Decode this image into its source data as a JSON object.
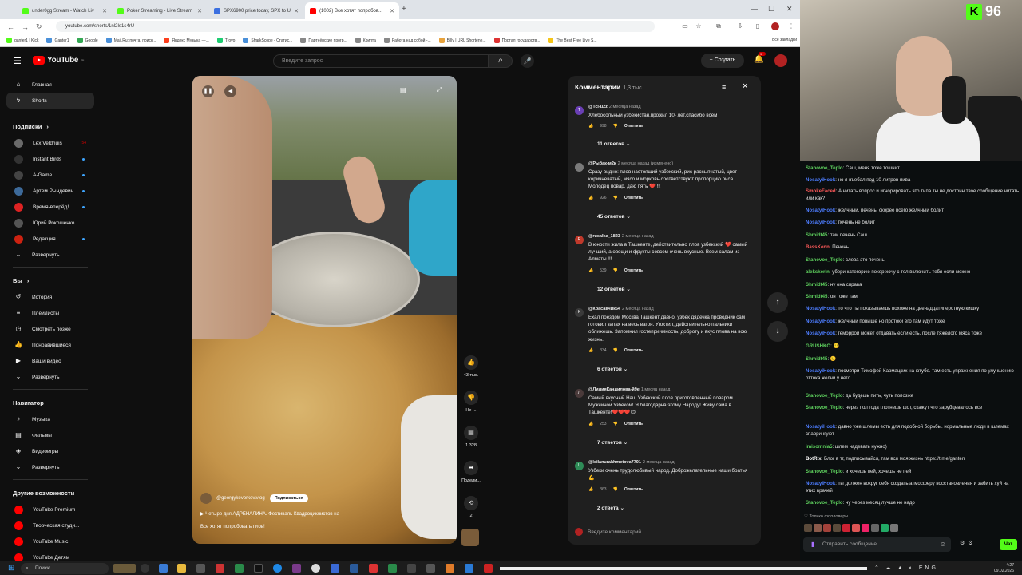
{
  "browser": {
    "tabs": [
      {
        "label": "under0gg Stream - Watch Liv",
        "color": "#53fc18"
      },
      {
        "label": "Poker Streaming - Live Stream",
        "color": "#53fc18"
      },
      {
        "label": "SPX6900 price today, SPX to U",
        "color": "#3b6fe0"
      },
      {
        "label": "(1002) Все хотят попробов...",
        "color": "#ff0000"
      }
    ],
    "url": "youtube.com/shorts/1nl2Is1s4rU",
    "bookmarks": [
      "ganter1 | Kick",
      "Ganter1",
      "Google",
      "Mail.Ru: почта, поиск...",
      "Яндекс Музыка —...",
      "Trovo",
      "SharkScope - Статис...",
      "Партнёрские прогр...",
      "Крипта",
      "Работа над собой -...",
      "Billy | URL Shortene...",
      "Портал государств...",
      "The Best Free Live S..."
    ],
    "all_bookmarks": "Все закладки"
  },
  "youtube": {
    "logo": "YouTube",
    "logo_sup": "RU",
    "search_placeholder": "Введите запрос",
    "create_label": "Создать",
    "notif_count": "9+",
    "sidebar": {
      "main": [
        {
          "label": "Главная",
          "icon": "home-icon",
          "glyph": "⌂"
        },
        {
          "label": "Shorts",
          "icon": "shorts-icon",
          "glyph": "ϟ"
        }
      ],
      "subs_header": "Подписки",
      "subs": [
        {
          "label": "Lex Veldhuis",
          "color": "#6a6a6a",
          "count": "54"
        },
        {
          "label": "Instant Birds",
          "color": "#333"
        },
        {
          "label": "A-Game",
          "color": "#444"
        },
        {
          "label": "Артем Рындевич",
          "color": "#3d6a9a"
        },
        {
          "label": "Время-вперёд!",
          "color": "#d22"
        },
        {
          "label": "Юрий Рокошенко",
          "color": "#555"
        },
        {
          "label": "Редакция",
          "color": "#c21"
        }
      ],
      "expand": "Развернуть",
      "you_header": "Вы",
      "you": [
        {
          "label": "История",
          "glyph": "↺",
          "icon": "history-icon"
        },
        {
          "label": "Плейлисты",
          "glyph": "≡",
          "icon": "playlists-icon"
        },
        {
          "label": "Смотреть позже",
          "glyph": "◷",
          "icon": "watch-later-icon"
        },
        {
          "label": "Понравившиеся",
          "glyph": "👍",
          "icon": "liked-icon"
        },
        {
          "label": "Ваши видео",
          "glyph": "▶",
          "icon": "your-videos-icon"
        },
        {
          "label": "Развернуть",
          "glyph": "⌄",
          "icon": "chevron-down-icon"
        }
      ],
      "nav_header": "Навигатор",
      "nav": [
        {
          "label": "Музыка",
          "glyph": "♪",
          "icon": "music-icon"
        },
        {
          "label": "Фильмы",
          "glyph": "🎞",
          "icon": "films-icon"
        },
        {
          "label": "Видеоигры",
          "glyph": "🎮",
          "icon": "games-icon"
        },
        {
          "label": "Развернуть",
          "glyph": "⌄",
          "icon": "chevron-down-icon"
        }
      ],
      "more_header": "Другие возможности",
      "more": [
        {
          "label": "YouTube Premium",
          "color": "#f00"
        },
        {
          "label": "Творческая студи...",
          "color": "#f00"
        },
        {
          "label": "YouTube Music",
          "color": "#f00"
        },
        {
          "label": "YouTube Детям",
          "color": "#f00"
        }
      ]
    },
    "video": {
      "channel": "@georgykevorkov.vlog",
      "subscribe": "Подписаться",
      "title_line1": "Четыре дня АДРЕНАЛИНА. Фестиваль Квадроциклистов на",
      "title_line2": "Все хотят попробовать плов!"
    },
    "actions": {
      "likes": "43 тыс.",
      "dislike": "Не ...",
      "comments": "1 328",
      "share": "Подели...",
      "remix": "2"
    },
    "comments_panel": {
      "title": "Комментарии",
      "count": "1,3 тыс.",
      "input_placeholder": "Введите комментарий",
      "reply_label": "Ответить",
      "items": [
        {
          "author": "@Tcl-u2z",
          "time": "2 месяца назад",
          "avatar_letter": "T",
          "avatar_color": "#6a3fb5",
          "text": "Хлебосольный узбекистан.прожил 10- лет.спасибо всем",
          "likes": "998",
          "replies": "11 ответов"
        },
        {
          "author": "@Рыбак-м2к",
          "time": "2 месяца назад (изменено)",
          "avatar_letter": "",
          "avatar_color": "#7a7a7a",
          "text": "Сразу видно: плов настоящий узбекский, рис рассыпчатый, цвет коричневатый, мясо и морковь соответствуют пропорцию риса. Молодец повар, даю пять ❤️ !!!",
          "likes": "926",
          "replies": "45 ответов"
        },
        {
          "author": "@rusalka_1823",
          "time": "2 месяца назад",
          "avatar_letter": "R",
          "avatar_color": "#c0392b",
          "text": "В юности жила в Ташкенте, действительно плов узбекский ❤️ самый лучший, а овощи и фрукты совсем очень вкусные. Всем салам из Алматы !!!",
          "likes": "539",
          "replies": "12 ответов"
        },
        {
          "author": "@Красавчик54",
          "time": "2 месяца назад",
          "avatar_letter": "K",
          "avatar_color": "#3a3a3a",
          "text": "Ехал поездом Москва Ташкент давно, узбек дядечка проводник сам готовил запах на весь вагон. Угостил, действительно пальчики оближешь. Запомнил гостеприимность, доброту и вкус плова на всю жизнь.",
          "likes": "334",
          "replies": "6 ответов"
        },
        {
          "author": "@ЛилияКандилова-й9е",
          "time": "1 месяц назад",
          "avatar_letter": "Л",
          "avatar_color": "#4a3a3a",
          "text": "Самый вкусный Наш Узбекский плов приготовленный поваром Мужчиной Узбеком! Я благодарна этому Народу! Живу сама в Ташкенте!❤️❤️❤️😊",
          "likes": "253",
          "replies": "7 ответов"
        },
        {
          "author": "@leilanurakhmetova7701",
          "time": "2 месяца назад",
          "avatar_letter": "L",
          "avatar_color": "#2e8b57",
          "text": "Узбеки очень трудолюбивый народ. Доброжелательные наши братья💪",
          "likes": "363",
          "replies": "2 ответа"
        }
      ]
    }
  },
  "stream": {
    "viewer_count": "96",
    "chat": [
      {
        "user": "Stanovoe_Teplo",
        "color": "#5fd35f",
        "text": "Саш, меня тоже тошнит"
      },
      {
        "user": "NosatyiHook",
        "color": "#4d7dff",
        "text": "но я въебал под 10 литров пива"
      },
      {
        "user": "SmokeFaced",
        "color": "#ff5a5a",
        "text": "А читать вопрос и игнорировать это типа ты не достоин твое сообщение читать или как?"
      },
      {
        "user": "NosatyiHook",
        "color": "#4d7dff",
        "text": "желчный, печень. скорее всего желчный болит"
      },
      {
        "user": "NosatyiHook",
        "color": "#4d7dff",
        "text": "печень не болит"
      },
      {
        "user": "Shmidt45",
        "color": "#5fd35f",
        "text": "там печень Саш"
      },
      {
        "user": "BassKenn",
        "color": "#ff5a5a",
        "text": "Печень ..."
      },
      {
        "user": "Stanovoe_Teplo",
        "color": "#5fd35f",
        "text": "слева это печень"
      },
      {
        "user": "alekskerin",
        "color": "#5fd35f",
        "text": "убери категорию покер хочу с тел включить тебя если можно"
      },
      {
        "user": "Shmidt45",
        "color": "#5fd35f",
        "text": "ну она справа"
      },
      {
        "user": "Shmidt45",
        "color": "#5fd35f",
        "text": "он тоже там"
      },
      {
        "user": "NosatyiHook",
        "color": "#4d7dff",
        "text": "то что ты показываешь похоже на двенадцатиперстную кишку"
      },
      {
        "user": "NosatyiHook",
        "color": "#4d7dff",
        "text": "желчный повыше но протоки его там идут тоже"
      },
      {
        "user": "NosatyiHook",
        "color": "#4d7dff",
        "text": "геморрой может отдавать если есть. после тяжелого мяса тоже"
      },
      {
        "user": "GRUSHKO",
        "color": "#5fd35f",
        "text": "🙂"
      },
      {
        "user": "Shmidt45",
        "color": "#5fd35f",
        "text": "🙂"
      },
      {
        "user": "NosatyiHook",
        "color": "#4d7dff",
        "text": "посмотри Тимофей Кармацких на ютубе. там есть упражнения по улучшению оттока желчи у него"
      },
      {
        "user": "Stanovoe_Teplo",
        "color": "#5fd35f",
        "text": "да будешь пить, чуть попозже"
      },
      {
        "user": "Stanovoe_Teplo",
        "color": "#5fd35f",
        "text": "через пол года глотнешь шот, скажут что зарубцевалось все"
      },
      {
        "user": "NosatyiHook",
        "color": "#4d7dff",
        "text": "давно уже шлемы есть для подобной борьбы. нормальные люди в шлемах спаррингуют"
      },
      {
        "user": "imisomnia5",
        "color": "#5fd35f",
        "text": "шлем надевать нужно)"
      },
      {
        "user": "BotRix",
        "color": "#ffffff",
        "text": "Блог в тг, подписывайся, там вся моя жизнь https://t.me/ganterr"
      },
      {
        "user": "Stanovoe_Teplo",
        "color": "#5fd35f",
        "text": "и хочешь пей, хочешь не пей"
      },
      {
        "user": "NosatyiHook",
        "color": "#4d7dff",
        "text": "ты должен вокруг себя создать атмосферу восстановления и забить хуй на этих врачей"
      },
      {
        "user": "Stanovoe_Teplo",
        "color": "#5fd35f",
        "text": "ну через месяц лучше не надо"
      }
    ],
    "followers_only": "♡ Только фолловеры",
    "chat_placeholder": "Отправить сообщение",
    "chat_button": "Чат"
  },
  "taskbar": {
    "search": "Поиск",
    "lang": "ENG",
    "time": "4:27",
    "date": "09.02.2026"
  }
}
